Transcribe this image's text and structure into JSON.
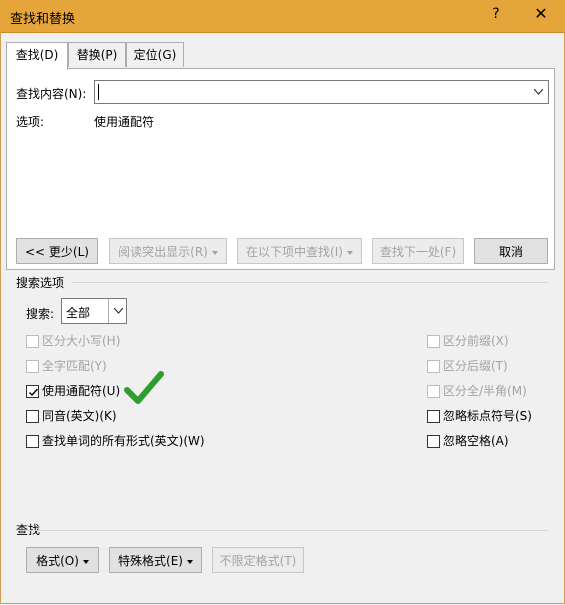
{
  "window": {
    "title": "查找和替换",
    "help_label": "?",
    "close_label": "✕"
  },
  "tabs": [
    {
      "label": "查找(D)",
      "active": true
    },
    {
      "label": "替换(P)",
      "active": false
    },
    {
      "label": "定位(G)",
      "active": false
    }
  ],
  "find": {
    "label": "查找内容(N):",
    "value": "",
    "options_label": "选项:",
    "options_value": "使用通配符"
  },
  "buttons": {
    "less": "<< 更少(L)",
    "highlight": "阅读突出显示(R)",
    "find_in": "在以下项中查找(I)",
    "find_next": "查找下一处(F)",
    "cancel": "取消"
  },
  "search_options": {
    "section_label": "搜索选项",
    "search_label": "搜索:",
    "search_value": "全部"
  },
  "checkboxes_left": [
    {
      "label": "区分大小写(H)",
      "checked": false,
      "enabled": false
    },
    {
      "label": "全字匹配(Y)",
      "checked": false,
      "enabled": false
    },
    {
      "label": "使用通配符(U)",
      "checked": true,
      "enabled": true
    },
    {
      "label": "同音(英文)(K)",
      "checked": false,
      "enabled": true
    },
    {
      "label": "查找单词的所有形式(英文)(W)",
      "checked": false,
      "enabled": true
    }
  ],
  "checkboxes_right": [
    {
      "label": "区分前缀(X)",
      "checked": false,
      "enabled": false
    },
    {
      "label": "区分后缀(T)",
      "checked": false,
      "enabled": false
    },
    {
      "label": "区分全/半角(M)",
      "checked": false,
      "enabled": false
    },
    {
      "label": "忽略标点符号(S)",
      "checked": false,
      "enabled": true
    },
    {
      "label": "忽略空格(A)",
      "checked": false,
      "enabled": true
    }
  ],
  "find_section": {
    "label": "查找",
    "format_button": "格式(O)",
    "special_button": "特殊格式(E)",
    "no_format_button": "不限定格式(T)"
  },
  "colors": {
    "title_bar": "#e5a53b",
    "checkmark": "#2e9e2e"
  }
}
